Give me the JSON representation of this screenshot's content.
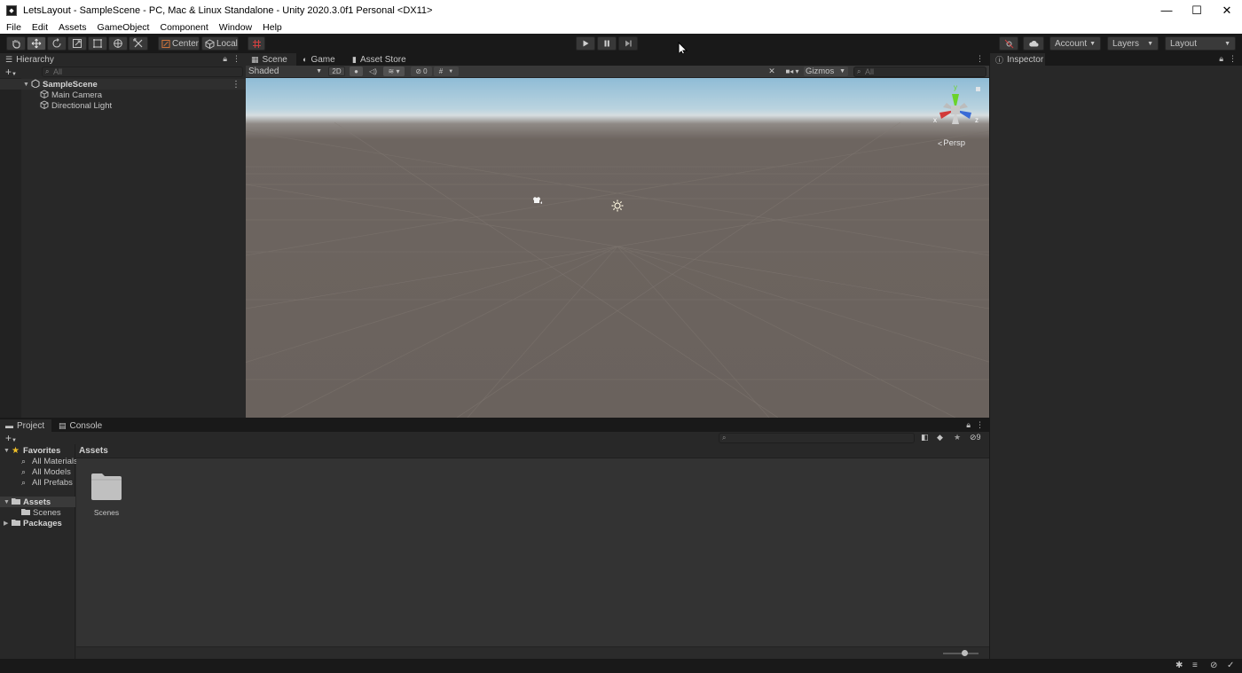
{
  "window": {
    "title": "LetsLayout - SampleScene - PC, Mac & Linux Standalone - Unity 2020.3.0f1 Personal <DX11>",
    "controls": {
      "minimize": "—",
      "maximize": "☐",
      "close": "✕"
    }
  },
  "menubar": {
    "items": [
      "File",
      "Edit",
      "Assets",
      "GameObject",
      "Component",
      "Window",
      "Help"
    ]
  },
  "toolbar": {
    "pivot_label": "Center",
    "space_label": "Local",
    "account_label": "Account",
    "layers_label": "Layers",
    "layout_label": "Layout"
  },
  "hierarchy": {
    "tab_label": "Hierarchy",
    "search_placeholder": "All",
    "scene_name": "SampleScene",
    "items": [
      "Main Camera",
      "Directional Light"
    ]
  },
  "scene": {
    "tabs": [
      "Scene",
      "Game",
      "Asset Store"
    ],
    "draw_mode": "Shaded",
    "mode_2d": "2D",
    "hidden_count": "0",
    "gizmos_label": "Gizmos",
    "search_placeholder": "All",
    "projection_label": "Persp",
    "gizmo_axes": {
      "x": "x",
      "y": "y",
      "z": "z"
    }
  },
  "inspector": {
    "tab_label": "Inspector"
  },
  "project": {
    "tabs": [
      "Project",
      "Console"
    ],
    "hidden_count": "9",
    "favorites_label": "Favorites",
    "favorites": [
      "All Materials",
      "All Models",
      "All Prefabs"
    ],
    "assets_label": "Assets",
    "assets_children": [
      "Scenes"
    ],
    "packages_label": "Packages",
    "breadcrumb": "Assets",
    "grid_items": [
      "Scenes"
    ],
    "zoom_level": 0.6
  },
  "colors": {
    "panel_bg": "#282828",
    "dark_bg": "#191919",
    "accent_green": "#6bd32a",
    "accent_red": "#d23a3a",
    "accent_blue": "#3a6bd6",
    "favorite_star": "#f0c028"
  }
}
